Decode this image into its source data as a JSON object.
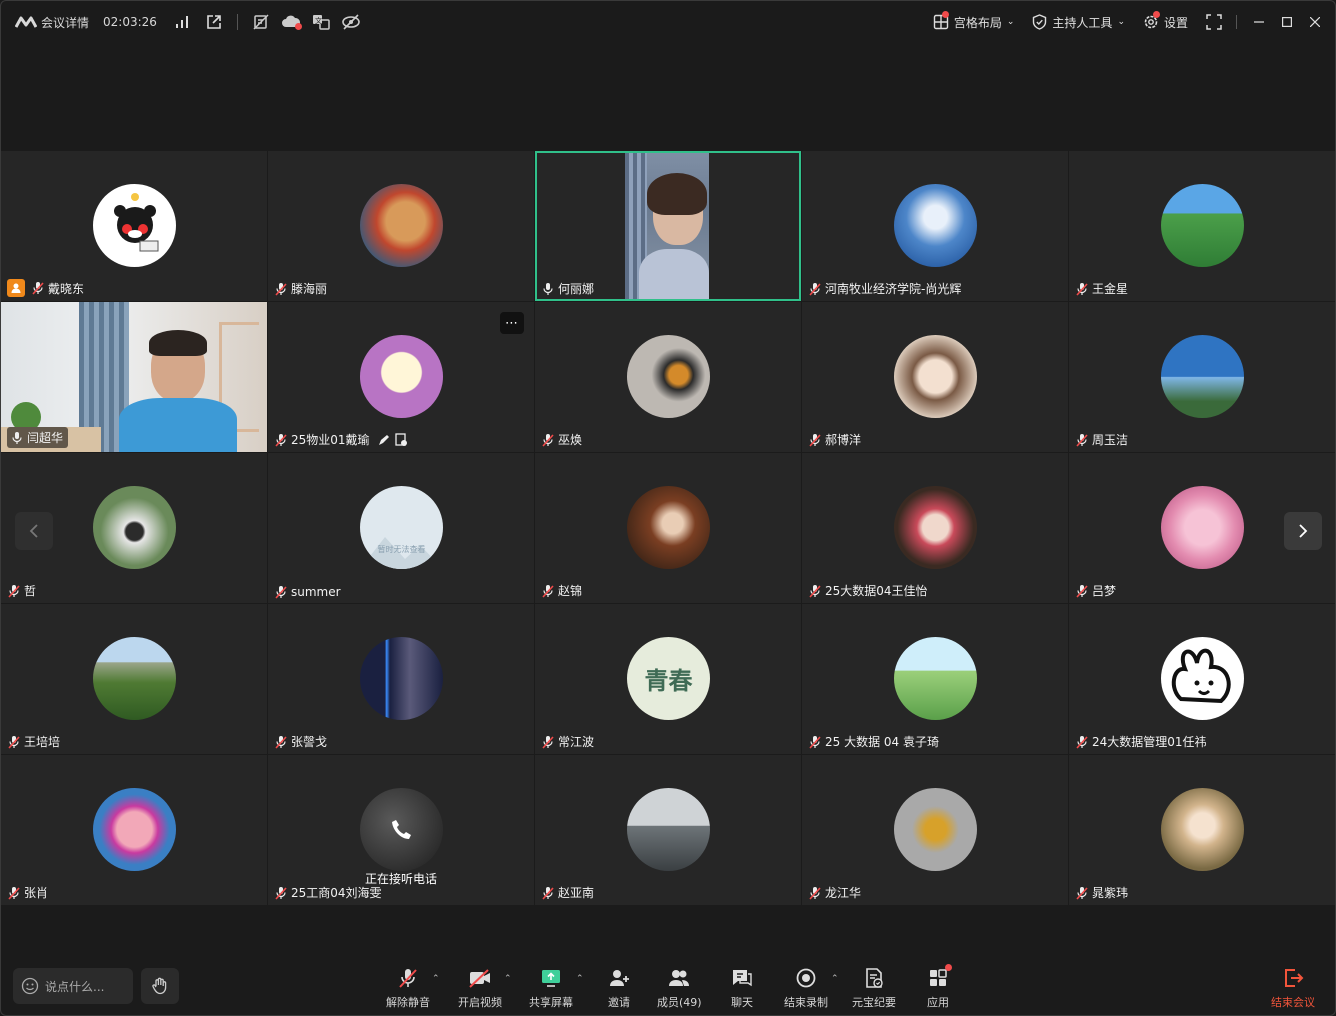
{
  "topbar": {
    "meeting_info_label": "会议详情",
    "duration": "02:03:26",
    "layout_label": "宫格布局",
    "host_tools_label": "主持人工具",
    "settings_label": "设置"
  },
  "participants": [
    {
      "name": "戴晓东",
      "host": true,
      "mic": "off",
      "avatar": "kumamon-avatar",
      "bg": "#ffffff"
    },
    {
      "name": "滕海丽",
      "mic": "off",
      "avatar": "toy-bear-avatar",
      "bg": "#e8b45a"
    },
    {
      "name": "何丽娜",
      "mic": "on",
      "avatar": "video-feed",
      "bg": "#6b7b91",
      "active": true
    },
    {
      "name": "河南牧业经济学院-尚光辉",
      "mic": "off",
      "avatar": "sky-clouds-avatar",
      "bg": "#4d86c9"
    },
    {
      "name": "王金星",
      "mic": "off",
      "avatar": "terraced-fields-avatar",
      "bg": "#3f9a4b"
    },
    {
      "name": "闫超华",
      "mic": "on",
      "avatar": "video-feed",
      "bg": "#9fb8c8",
      "boxed": true
    },
    {
      "name": "25物业01戴瑜",
      "mic": "off",
      "avatar": "cartoon-cloud-avatar",
      "bg": "#b874c4",
      "extras": true,
      "more": true
    },
    {
      "name": "巫焕",
      "mic": "off",
      "avatar": "flowers-photo-avatar",
      "bg": "#b9b4ae"
    },
    {
      "name": "郝博洋",
      "mic": "off",
      "avatar": "anime-boy-avatar",
      "bg": "#d9c8b8"
    },
    {
      "name": "周玉洁",
      "mic": "off",
      "avatar": "seaside-sign-avatar",
      "bg": "#2f74c2"
    },
    {
      "name": "哲",
      "mic": "off",
      "avatar": "garden-gate-avatar",
      "bg": "#8a9a7a"
    },
    {
      "name": "summer",
      "mic": "off",
      "avatar": "unavailable-placeholder",
      "bg": "#dfe8ee",
      "placeholder_text": "暂时无法查看"
    },
    {
      "name": "赵锦",
      "mic": "off",
      "avatar": "restaurant-photo-avatar",
      "bg": "#6a3b26"
    },
    {
      "name": "25大数据04王佳怡",
      "mic": "off",
      "avatar": "girl-photo-avatar",
      "bg": "#c9a08b"
    },
    {
      "name": "吕梦",
      "mic": "off",
      "avatar": "pink-house-avatar",
      "bg": "#e38cb0"
    },
    {
      "name": "王培培",
      "mic": "off",
      "avatar": "mountain-avatar",
      "bg": "#5a8a3c"
    },
    {
      "name": "张謦戈",
      "mic": "off",
      "avatar": "neon-figure-avatar",
      "bg": "#1a2040"
    },
    {
      "name": "常江波",
      "mic": "off",
      "avatar": "qingchun-calligraphy-avatar",
      "bg": "#e6ecdc",
      "calligraphy": "青春"
    },
    {
      "name": "25 大数据 04 袁子琦",
      "mic": "off",
      "avatar": "field-girl-avatar",
      "bg": "#9bcf7a"
    },
    {
      "name": "24大数据管理01任祎",
      "mic": "off",
      "avatar": "bunny-sketch-avatar",
      "bg": "#ffffff"
    },
    {
      "name": "张肖",
      "mic": "off",
      "avatar": "pig-photo-avatar",
      "bg": "#3a7fc4"
    },
    {
      "name": "25工商04刘海雯",
      "mic": "off",
      "avatar": "phone-call-avatar",
      "bg": "#2a2a2a",
      "phone_status": "正在接听电话"
    },
    {
      "name": "赵亚南",
      "mic": "off",
      "avatar": "grey-sea-avatar",
      "bg": "#9aa0a4"
    },
    {
      "name": "龙江华",
      "mic": "off",
      "avatar": "gold-dragon-avatar",
      "bg": "#a9a9a9"
    },
    {
      "name": "晁紫玮",
      "mic": "off",
      "avatar": "bear-hat-girl-avatar",
      "bg": "#a08a63"
    }
  ],
  "bottombar": {
    "say_placeholder": "说点什么...",
    "controls": {
      "unmute": "解除静音",
      "start_video": "开启视频",
      "share_screen": "共享屏幕",
      "invite": "邀请",
      "members": "成员(49)",
      "chat": "聊天",
      "end_recording": "结束录制",
      "yuanbao": "元宝纪要",
      "apps": "应用",
      "end_meeting": "结束会议"
    }
  },
  "colors": {
    "accent_green": "#30c08a",
    "danger": "#f2553b",
    "notify": "#f04b4b",
    "host_badge": "#f0891b"
  }
}
